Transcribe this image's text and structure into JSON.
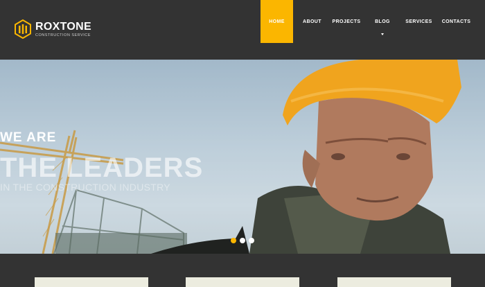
{
  "brand": {
    "name": "ROXTONE",
    "tagline": "CONSTRUCTION SERVICE",
    "logo_icon": "hexagon-logo-icon",
    "accent_color": "#fbb600"
  },
  "nav": {
    "items": [
      {
        "label": "HOME",
        "active": true
      },
      {
        "label": "ABOUT"
      },
      {
        "label": "PROJECTS"
      },
      {
        "label": "BLOG",
        "has_dropdown": true
      },
      {
        "label": "SERVICES"
      },
      {
        "label": "CONTACTS"
      }
    ]
  },
  "hero": {
    "line1": "WE ARE",
    "line2": "THE LEADERS",
    "line3": "IN THE CONSTRUCTION INDUSTRY",
    "slider_dots": 3,
    "active_slide": 1
  },
  "colors": {
    "background": "#333333",
    "card": "#ececdf"
  }
}
